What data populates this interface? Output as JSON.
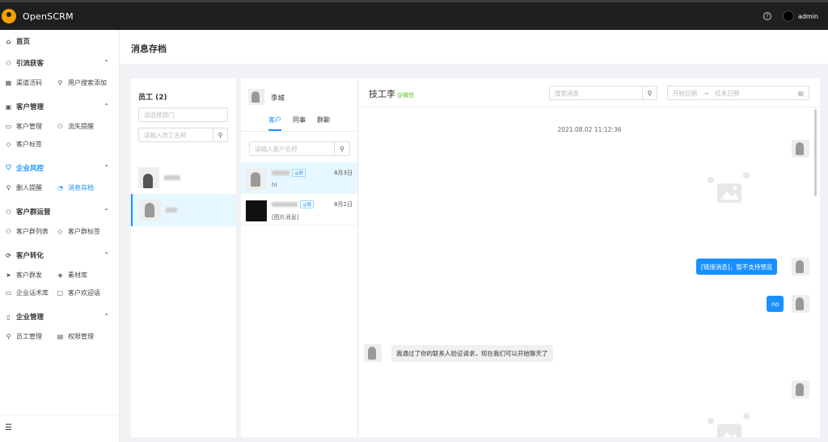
{
  "app": {
    "brand": "OpenSCRM",
    "help_icon": "question-circle-icon",
    "user_name": "admin"
  },
  "sidebar": {
    "home": "首页",
    "groups": [
      {
        "title": "引流获客",
        "items": [
          "渠道活码",
          "用户搜索添加"
        ]
      },
      {
        "title": "客户管理",
        "items": [
          "客户管理",
          "流失提醒",
          "客户标签"
        ]
      },
      {
        "title": "企业风控",
        "items": [
          "删人提醒",
          "消息存档"
        ]
      },
      {
        "title": "客户群运营",
        "items": [
          "客户群列表",
          "客户群标签"
        ]
      },
      {
        "title": "客户转化",
        "items": [
          "客户群发",
          "素材库",
          "企业话术库",
          "客户欢迎语"
        ]
      },
      {
        "title": "企业管理",
        "items": [
          "员工管理",
          "权限管理"
        ]
      }
    ],
    "active_group": "企业风控",
    "active_item": "消息存档",
    "collapse_icon": "menu-fold-icon"
  },
  "page": {
    "title": "消息存档"
  },
  "employees": {
    "title": "员工 (2)",
    "dept_placeholder": "请选择部门",
    "name_placeholder": "请输入员工名称"
  },
  "customers": {
    "selected_name": "李城",
    "tabs": [
      "客户",
      "同事",
      "群聊"
    ],
    "active_tab": "客户",
    "search_placeholder": "请输入客户名称",
    "list": [
      {
        "badge": "@微",
        "date": "8月3日",
        "preview": "hi"
      },
      {
        "badge": "@微",
        "date": "8月2日",
        "preview": "[图片消息]"
      }
    ]
  },
  "chat": {
    "contact": "技工李",
    "contact_tag": "@微信",
    "search_placeholder": "搜索消息",
    "start_date_placeholder": "开始日期",
    "end_date_placeholder": "结束日期",
    "timestamp": "2021.08.02 11:12:36",
    "messages": [
      {
        "side": "me",
        "type": "image"
      },
      {
        "side": "me",
        "type": "text",
        "text": "[链接消息]，暂不支持预览"
      },
      {
        "side": "me",
        "type": "text",
        "text": "no"
      },
      {
        "side": "other",
        "type": "text",
        "text": "我通过了你的联系人验证请求，现在我们可以开始聊天了"
      },
      {
        "side": "me",
        "type": "image"
      }
    ]
  },
  "colors": {
    "accent": "#1890ff",
    "topbar": "#1f1f1f",
    "wechat_green": "#52c41a"
  }
}
